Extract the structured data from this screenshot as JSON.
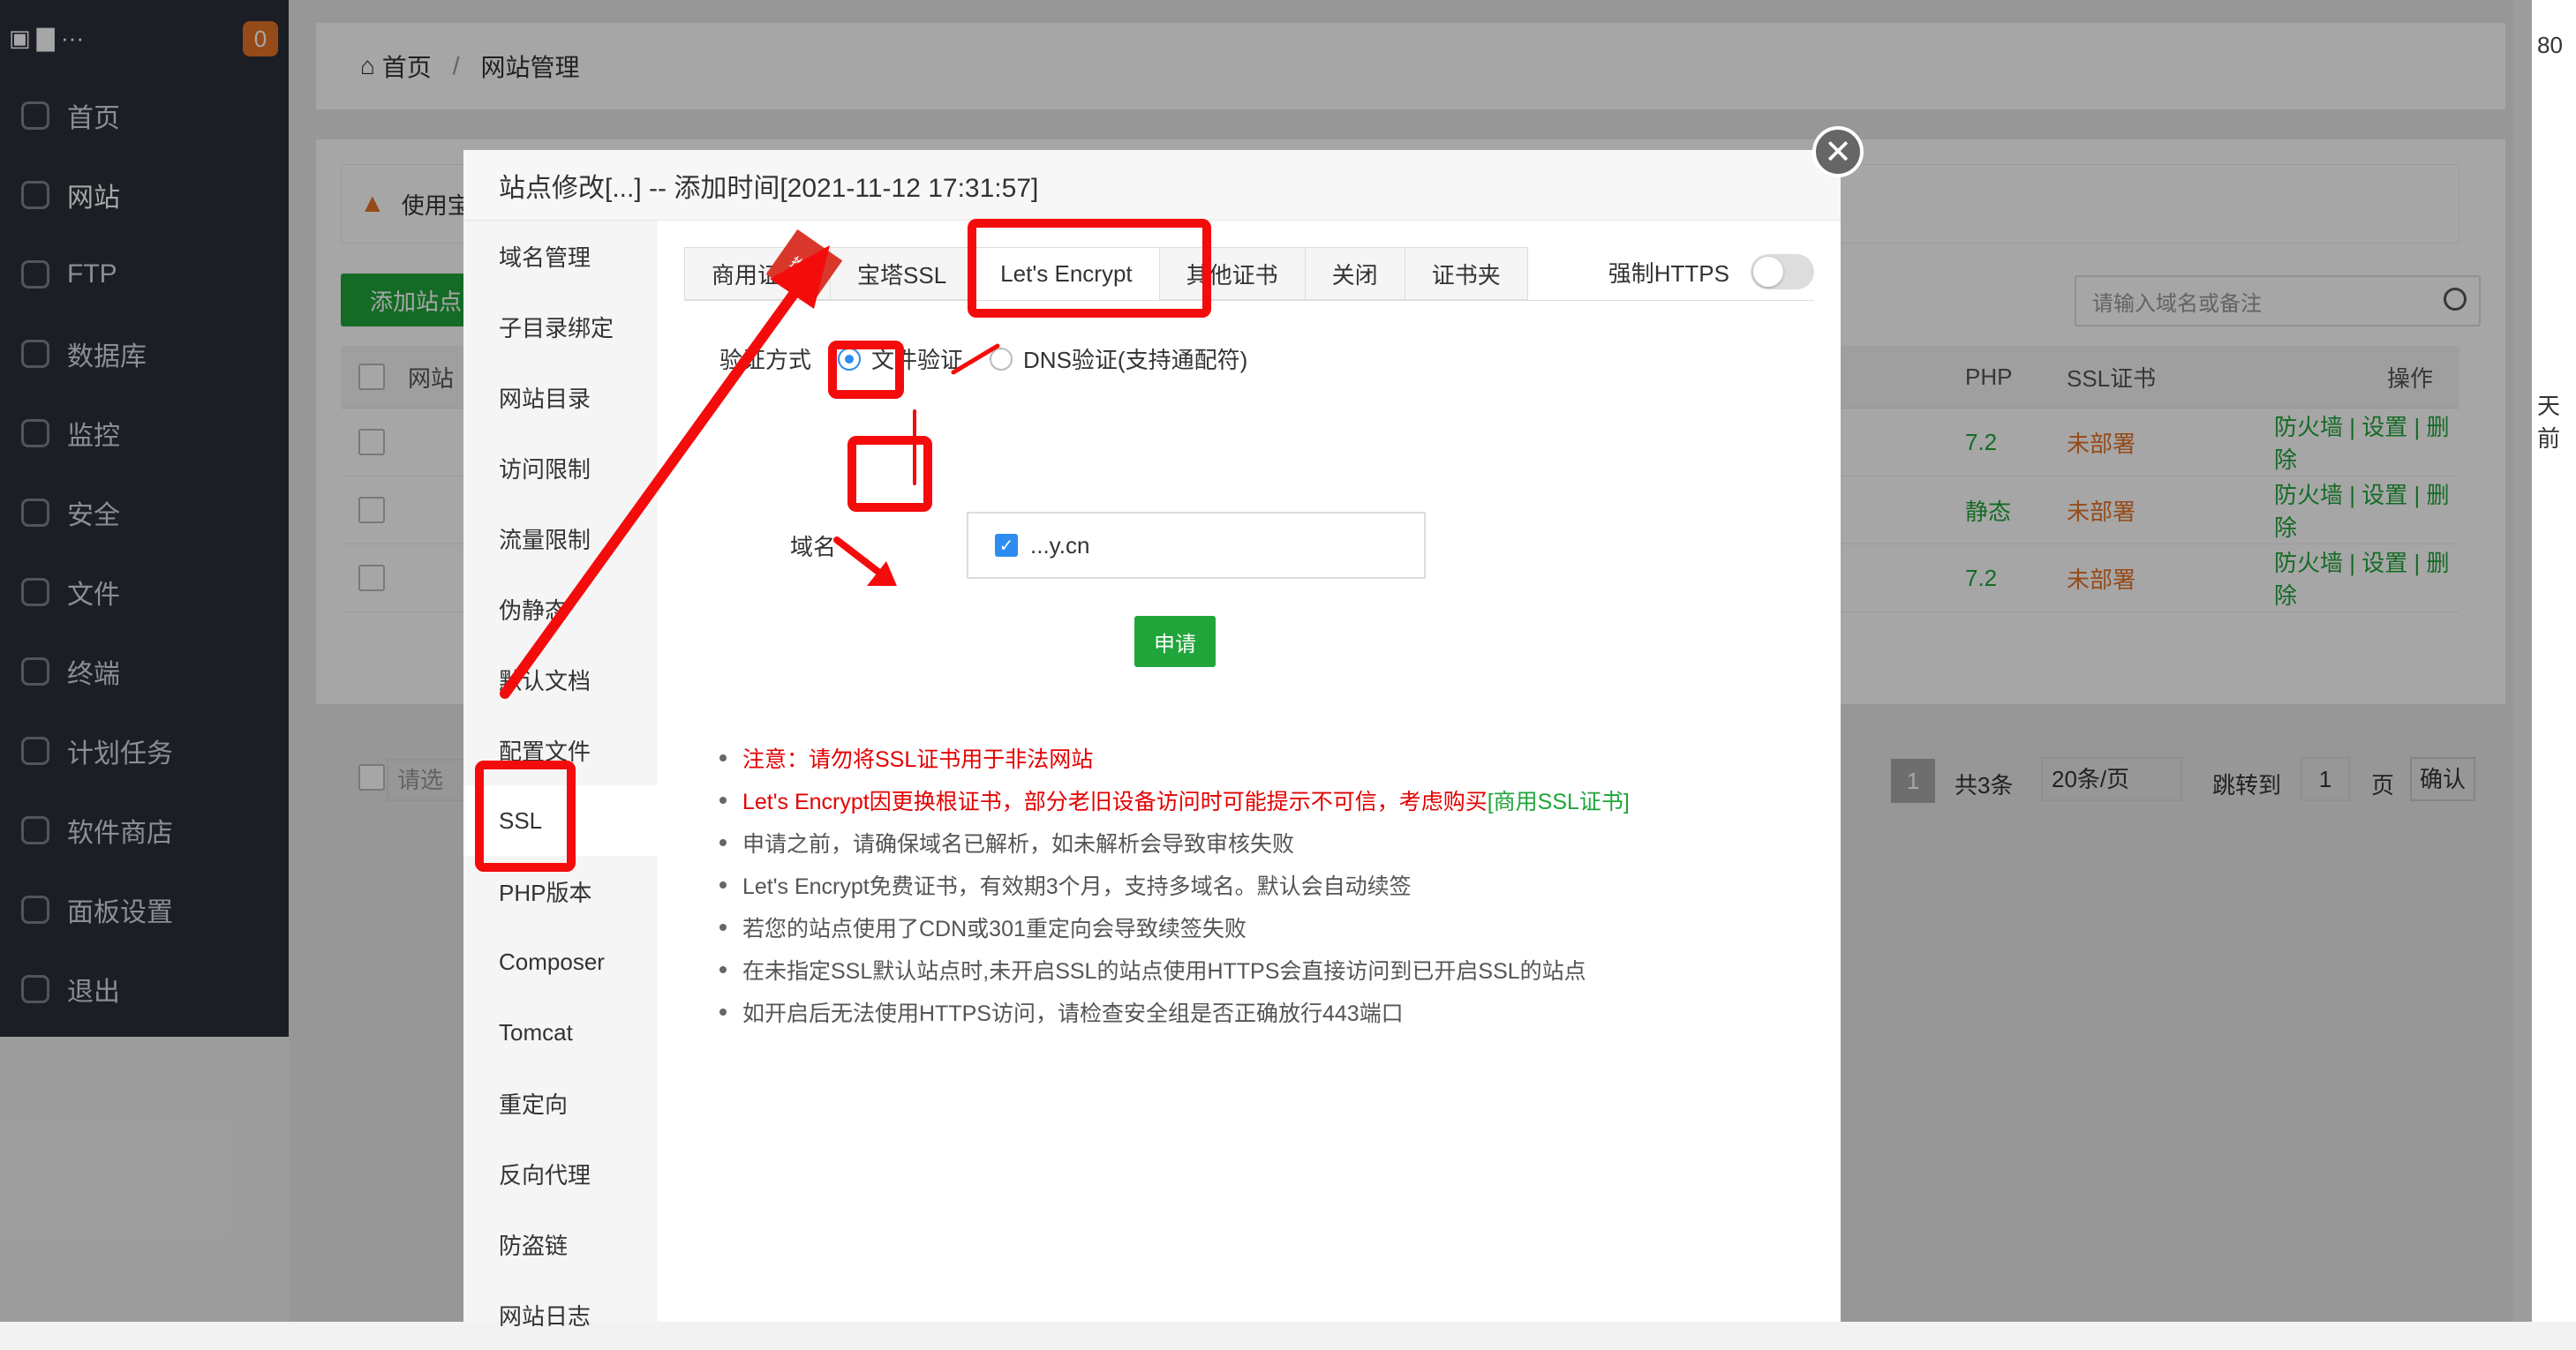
{
  "sidebar": {
    "badge": "0",
    "items": [
      {
        "label": "首页",
        "icon": "home-icon"
      },
      {
        "label": "网站",
        "icon": "globe-icon"
      },
      {
        "label": "FTP",
        "icon": "ftp-icon"
      },
      {
        "label": "数据库",
        "icon": "database-icon"
      },
      {
        "label": "监控",
        "icon": "monitor-icon"
      },
      {
        "label": "安全",
        "icon": "shield-icon"
      },
      {
        "label": "文件",
        "icon": "folder-icon"
      },
      {
        "label": "终端",
        "icon": "terminal-icon"
      },
      {
        "label": "计划任务",
        "icon": "calendar-icon"
      },
      {
        "label": "软件商店",
        "icon": "grid-icon"
      },
      {
        "label": "面板设置",
        "icon": "gear-icon"
      },
      {
        "label": "退出",
        "icon": "logout-icon"
      }
    ]
  },
  "breadcrumb": {
    "home": "首页",
    "sep": "/",
    "current": "网站管理"
  },
  "main": {
    "warning_text": "使用宝",
    "add_site": "添加站点",
    "search_placeholder": "请输入域名或备注",
    "columns": {
      "site": "网站",
      "php": "PHP",
      "ssl": "SSL证书",
      "ops": "操作"
    },
    "rows": [
      {
        "php": "7.2",
        "ssl": "未部署",
        "firewall": "防火墙",
        "settings": "设置",
        "delete": "删除"
      },
      {
        "php": "静态",
        "ssl": "未部署",
        "firewall": "防火墙",
        "settings": "设置",
        "delete": "删除"
      },
      {
        "php": "7.2",
        "ssl": "未部署",
        "firewall": "防火墙",
        "settings": "设置",
        "delete": "删除"
      }
    ],
    "bulk_placeholder": "请选",
    "pager": {
      "page": "1",
      "total": "共3条",
      "per_page": "20条/页",
      "jump": "跳转到",
      "jump_value": "1",
      "page_unit": "页",
      "confirm": "确认"
    }
  },
  "rightstrip": {
    "text1": "80",
    "text2": "天前"
  },
  "modal": {
    "title": "站点修改[...] -- 添加时间[2021-11-12 17:31:57]",
    "nav": [
      "域名管理",
      "子目录绑定",
      "网站目录",
      "访问限制",
      "流量限制",
      "伪静态",
      "默认文档",
      "配置文件",
      "SSL",
      "PHP版本",
      "Composer",
      "Tomcat",
      "重定向",
      "反向代理",
      "防盗链",
      "网站日志"
    ],
    "tabs": [
      "商用证书",
      "宝塔SSL",
      "Let's Encrypt",
      "其他证书",
      "关闭",
      "证书夹"
    ],
    "ribbon": "推荐",
    "force_https": "强制HTTPS",
    "verify_label": "验证方式",
    "verify_file": "文件验证",
    "verify_dns": "DNS验证(支持通配符)",
    "domain_label": "域名",
    "domain_value": "...y.cn",
    "apply": "申请",
    "notes": {
      "n1": "注意：请勿将SSL证书用于非法网站",
      "n2a": "Let's Encrypt因更换根证书，部分老旧设备访问时可能提示不可信，考虑购买",
      "n2b": "[商用SSL证书]",
      "n3": "申请之前，请确保域名已解析，如未解析会导致审核失败",
      "n4": "Let's Encrypt免费证书，有效期3个月，支持多域名。默认会自动续签",
      "n5": "若您的站点使用了CDN或301重定向会导致续签失败",
      "n6": "在未指定SSL默认站点时,未开启SSL的站点使用HTTPS会直接访问到已开启SSL的站点",
      "n7": "如开启后无法使用HTTPS访问，请检查安全组是否正确放行443端口"
    }
  },
  "colors": {
    "accent_green": "#20a53a",
    "annotation_red": "#f40c0c",
    "warning_orange": "#e57425"
  }
}
